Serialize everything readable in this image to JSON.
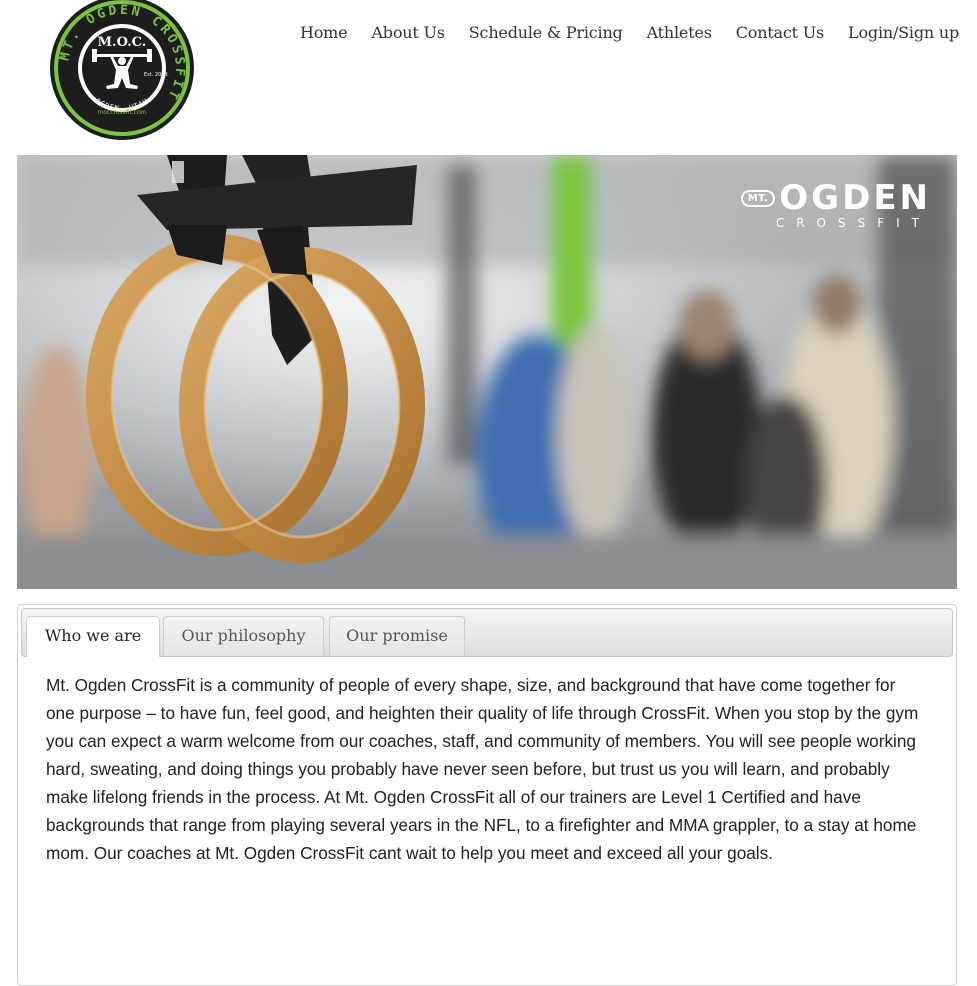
{
  "logo": {
    "ring_text": "MT. OGDEN CROSSFIT",
    "center_text": "M.O.C.",
    "est": "Est. 2013",
    "url": "moccrossfit.com",
    "city": "OGDEN, UTAH"
  },
  "nav": {
    "items": [
      "Home",
      "About Us",
      "Schedule & Pricing",
      "Athletes",
      "Contact Us",
      "Login/Sign up"
    ]
  },
  "hero": {
    "brand_mt": "MT.",
    "brand_name": "OGDEN",
    "brand_sub": "CROSSFIT"
  },
  "tabs": {
    "items": [
      "Who we are",
      "Our philosophy",
      "Our promise"
    ],
    "active": "Who we are",
    "content": "Mt. Ogden CrossFit is a community of people of every shape, size, and background that have come together for one purpose – to have fun, feel good, and heighten their quality of life through CrossFit. When you stop by the gym you can expect a warm welcome from our coaches, staff, and community of members. You will see people working hard, sweating, and doing things you probably have never seen before, but trust us you will learn, and probably make lifelong friends in the process. At Mt. Ogden CrossFit all of our trainers are Level 1 Certified and have backgrounds that range from playing several years in the NFL, to a firefighter and MMA grappler, to a stay at home mom. Our coaches at Mt. Ogden CrossFit cant wait to help you meet and exceed all your goals."
  },
  "colors": {
    "accent_green": "#7dc243",
    "text": "#222222"
  }
}
